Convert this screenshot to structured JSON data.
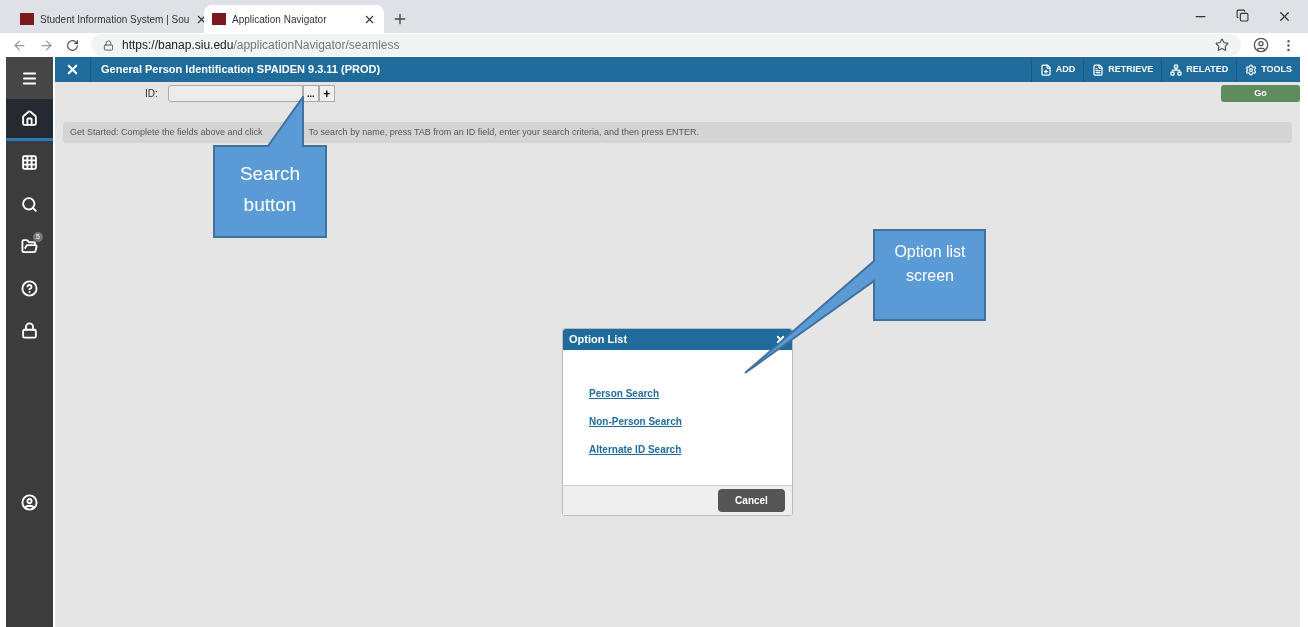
{
  "browser": {
    "tabs": [
      {
        "title": "Student Information System | Sou",
        "selected": false
      },
      {
        "title": "Application Navigator",
        "selected": true
      }
    ],
    "url_host": "https://banap.siu.edu",
    "url_path": "/applicationNavigator/seamless"
  },
  "sidebar": {
    "items": [
      {
        "kind": "menu",
        "selected": false
      },
      {
        "kind": "home",
        "selected": true
      },
      {
        "kind": "grid",
        "selected": false
      },
      {
        "kind": "search",
        "selected": false
      },
      {
        "kind": "folder",
        "selected": false,
        "badge": "5"
      },
      {
        "kind": "help",
        "selected": false
      },
      {
        "kind": "lock",
        "selected": false
      },
      {
        "kind": "user",
        "selected": false
      }
    ]
  },
  "header": {
    "title": "General Person Identification SPAIDEN 9.3.11 (PROD)",
    "actions": [
      {
        "kind": "add",
        "label": "ADD"
      },
      {
        "kind": "retrieve",
        "label": "RETRIEVE"
      },
      {
        "kind": "related",
        "label": "RELATED"
      },
      {
        "kind": "tools",
        "label": "TOOLS"
      }
    ]
  },
  "key_block": {
    "id_label": "ID:",
    "search_button": "...",
    "add_button": "+",
    "go_button": "Go"
  },
  "hint": {
    "before": "Get Started: Complete the fields above and click",
    "after": "To search by name, press TAB from an ID field, enter your search criteria, and then press ENTER."
  },
  "dialog": {
    "title": "Option List",
    "links": [
      "Person Search",
      "Non-Person Search",
      "Alternate ID Search"
    ],
    "cancel": "Cancel"
  },
  "callouts": [
    {
      "text": "Search button"
    },
    {
      "text": "Option list screen"
    }
  ]
}
